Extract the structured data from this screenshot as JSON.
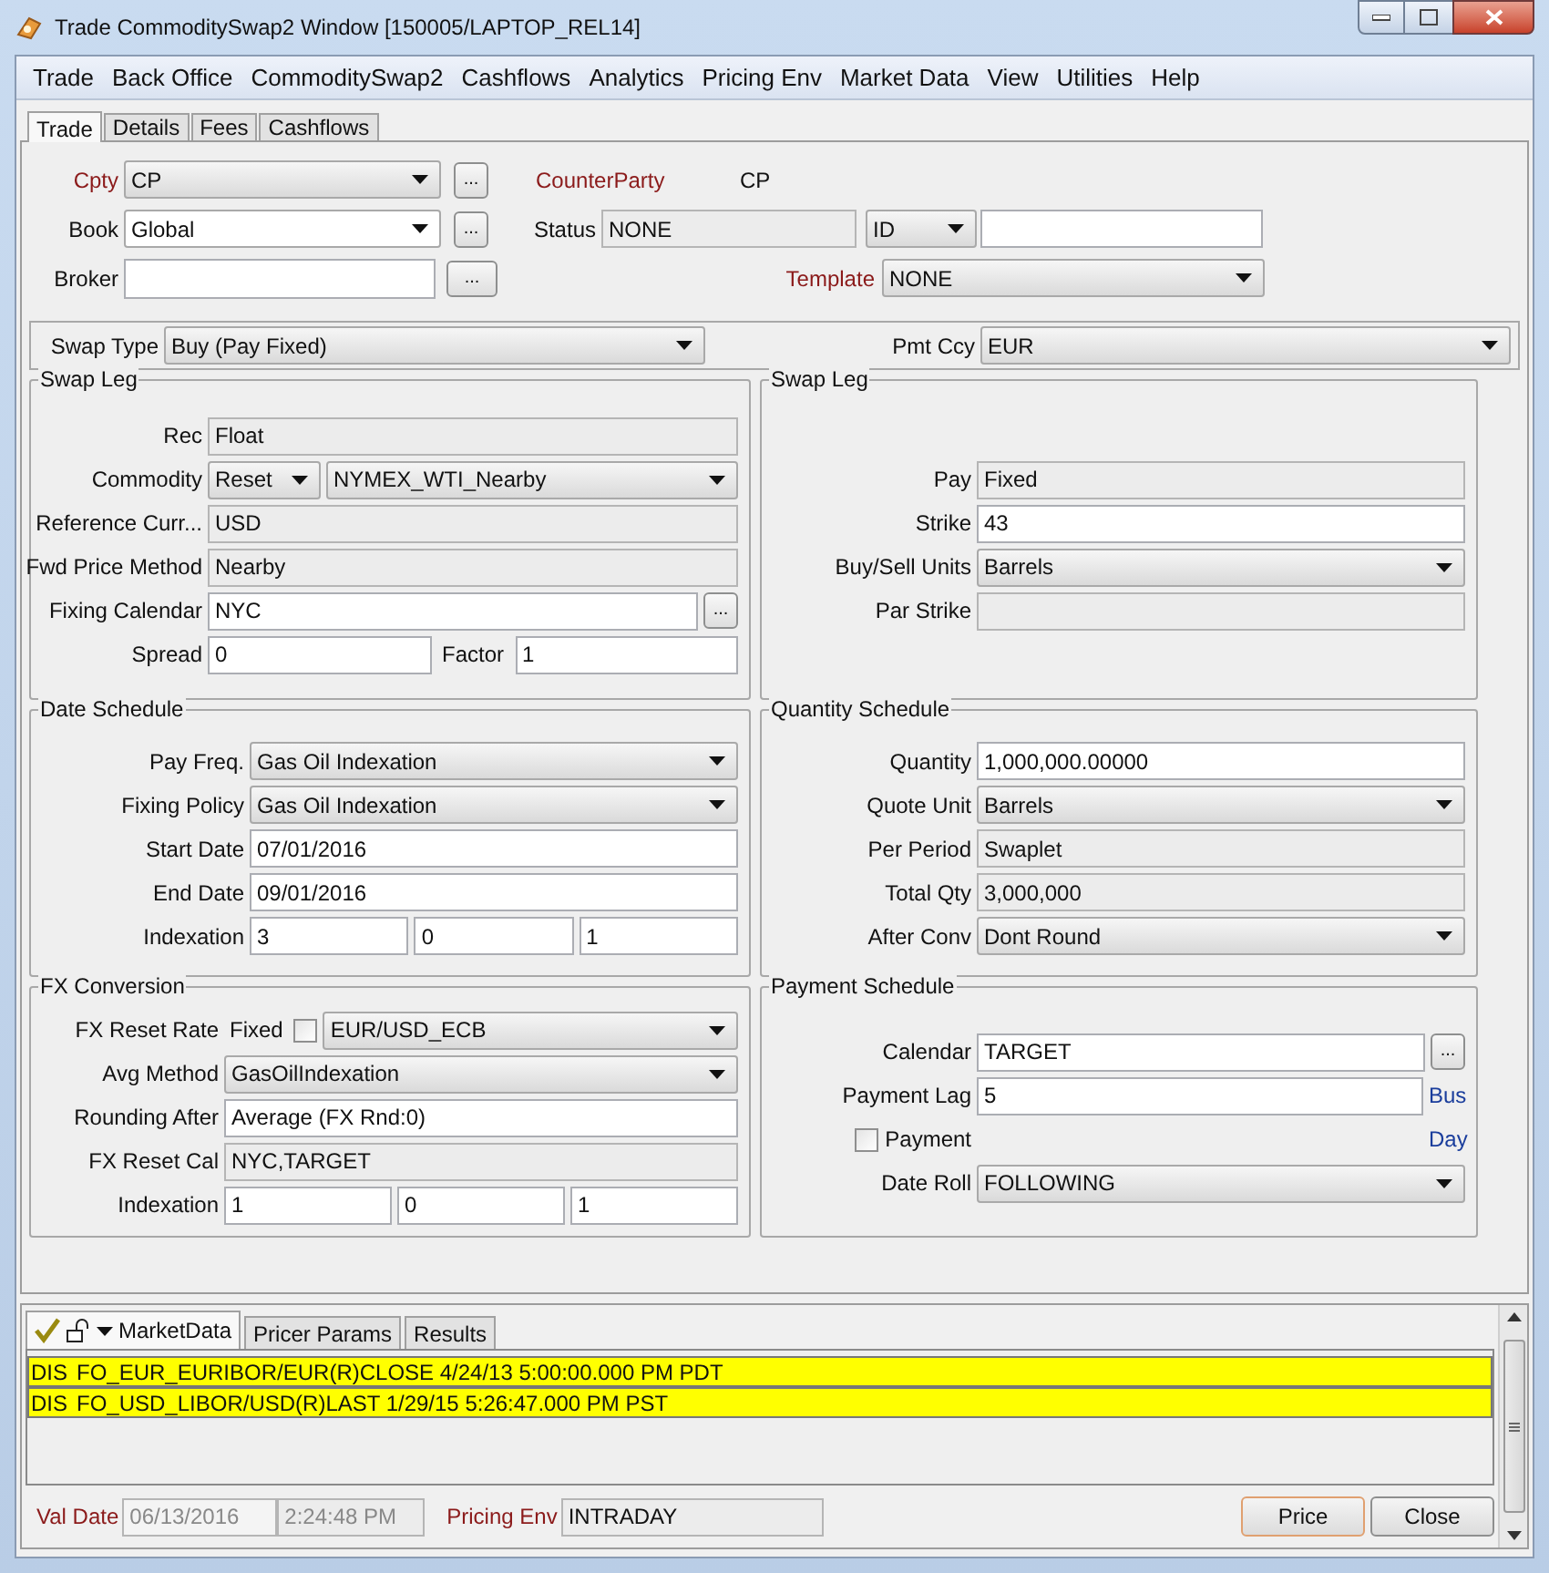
{
  "window": {
    "title": "Trade CommoditySwap2 Window  [150005/LAPTOP_REL14]"
  },
  "menu": [
    "Trade",
    "Back Office",
    "CommoditySwap2",
    "Cashflows",
    "Analytics",
    "Pricing Env",
    "Market Data",
    "View",
    "Utilities",
    "Help"
  ],
  "tabs": [
    {
      "label": "Trade",
      "selected": true
    },
    {
      "label": "Details",
      "selected": false
    },
    {
      "label": "Fees",
      "selected": false
    },
    {
      "label": "Cashflows",
      "selected": false
    }
  ],
  "header": {
    "cpty": {
      "label": "Cpty",
      "required": true,
      "value": "CP",
      "button": "..."
    },
    "counterparty": {
      "label": "CounterParty",
      "required": true,
      "value": "CP"
    },
    "book": {
      "label": "Book",
      "required": false,
      "value": "Global",
      "button": "..."
    },
    "status": {
      "label": "Status",
      "required": false,
      "value": "NONE"
    },
    "id": {
      "type": "ID"
    },
    "broker": {
      "label": "Broker",
      "required": false,
      "button": "..."
    },
    "template": {
      "label": "Template",
      "required": true,
      "value": "NONE"
    }
  },
  "swap_type": {
    "label": "Swap Type",
    "value": "Buy (Pay Fixed)"
  },
  "pmt_ccy": {
    "label": "Pmt Ccy",
    "value": "EUR"
  },
  "panels": [
    {
      "title": "Swap Leg",
      "rows": [
        {
          "label": "Rec",
          "controls": [
            {
              "kind": "readonly",
              "value": "Float"
            }
          ]
        },
        {
          "label": "Commodity",
          "controls": [
            {
              "kind": "short_combo",
              "value": "Reset"
            },
            {
              "kind": "combo",
              "value": "NYMEX_WTI_Nearby"
            }
          ]
        },
        {
          "label": "Reference Curr...",
          "controls": [
            {
              "kind": "readonly",
              "value": "USD"
            }
          ]
        },
        {
          "label": "Fwd Price Method",
          "controls": [
            {
              "kind": "readonly",
              "value": "Nearby"
            }
          ]
        },
        {
          "label": "Fixing Calendar",
          "controls": [
            {
              "kind": "text",
              "value": "NYC"
            },
            {
              "kind": "ellipsis",
              "label": "..."
            }
          ]
        },
        {
          "label": "Spread",
          "controls": [
            {
              "kind": "text",
              "value": "0"
            },
            {
              "kind": "label",
              "value": "Factor"
            },
            {
              "kind": "text",
              "value": "1"
            }
          ]
        }
      ]
    },
    {
      "title": "Swap Leg",
      "rows": [
        {
          "label": "Pay",
          "controls": [
            {
              "kind": "readonly",
              "value": "Fixed"
            }
          ]
        },
        {
          "label": "Strike",
          "controls": [
            {
              "kind": "text",
              "value": "43"
            }
          ]
        },
        {
          "label": "Buy/Sell Units",
          "controls": [
            {
              "kind": "combo",
              "value": "Barrels"
            }
          ]
        },
        {
          "label": "Par Strike",
          "controls": [
            {
              "kind": "readonly"
            }
          ]
        }
      ]
    },
    {
      "title": "Date Schedule",
      "rows": [
        {
          "label": "Pay Freq.",
          "controls": [
            {
              "kind": "combo",
              "value": "Gas Oil Indexation"
            }
          ]
        },
        {
          "label": "Fixing Policy",
          "controls": [
            {
              "kind": "combo",
              "value": "Gas Oil Indexation"
            }
          ]
        },
        {
          "label": "Start Date",
          "controls": [
            {
              "kind": "text",
              "value": "07/01/2016"
            }
          ]
        },
        {
          "label": "End Date",
          "controls": [
            {
              "kind": "text",
              "value": "09/01/2016"
            }
          ]
        },
        {
          "label": "Indexation",
          "controls": [
            {
              "kind": "text",
              "value": "3"
            },
            {
              "kind": "text",
              "value": "0"
            },
            {
              "kind": "text",
              "value": "1"
            }
          ]
        }
      ]
    },
    {
      "title": "Quantity Schedule",
      "rows": [
        {
          "label": "Quantity",
          "controls": [
            {
              "kind": "text",
              "value": "1,000,000.00000"
            }
          ]
        },
        {
          "label": "Quote Unit",
          "controls": [
            {
              "kind": "combo",
              "value": "Barrels"
            }
          ]
        },
        {
          "label": "Per Period",
          "controls": [
            {
              "kind": "readonly",
              "value": "Swaplet"
            }
          ]
        },
        {
          "label": "Total Qty",
          "controls": [
            {
              "kind": "readonly",
              "value": "3,000,000"
            }
          ]
        },
        {
          "label": "After Conv",
          "controls": [
            {
              "kind": "combo",
              "value": "Dont Round"
            }
          ]
        }
      ]
    },
    {
      "title": "FX Conversion",
      "rows": [
        {
          "label": "FX Reset Rate",
          "controls": [
            {
              "kind": "label",
              "value": "Fixed"
            },
            {
              "kind": "checkbox",
              "checked": false
            },
            {
              "kind": "combo",
              "value": "EUR/USD_ECB"
            }
          ]
        },
        {
          "label": "Avg Method",
          "controls": [
            {
              "kind": "combo",
              "value": "GasOilIndexation"
            }
          ]
        },
        {
          "label": "Rounding After",
          "controls": [
            {
              "kind": "text",
              "value": "Average (FX Rnd:0)"
            }
          ]
        },
        {
          "label": "FX Reset Cal",
          "controls": [
            {
              "kind": "readonly",
              "value": "NYC,TARGET"
            }
          ]
        },
        {
          "label": "Indexation",
          "controls": [
            {
              "kind": "text",
              "value": "1"
            },
            {
              "kind": "text",
              "value": "0"
            },
            {
              "kind": "text",
              "value": "1"
            }
          ]
        }
      ]
    },
    {
      "title": "Payment Schedule",
      "rows": [
        {
          "label": "Calendar",
          "controls": [
            {
              "kind": "text",
              "value": "TARGET"
            },
            {
              "kind": "ellipsis",
              "label": "..."
            }
          ]
        },
        {
          "label": "Payment Lag",
          "controls": [
            {
              "kind": "text",
              "value": "5"
            },
            {
              "kind": "suffix",
              "value": "Bus"
            }
          ]
        },
        {
          "check": {
            "label": "Payment",
            "checked": false
          },
          "controls": [
            {
              "kind": "gap"
            },
            {
              "kind": "suffix",
              "value": "Day"
            }
          ]
        },
        {
          "label": "Date Roll",
          "controls": [
            {
              "kind": "combo",
              "value": "FOLLOWING"
            }
          ]
        }
      ]
    }
  ],
  "bottom": {
    "tabs": [
      {
        "label": "MarketData",
        "selected": true
      },
      {
        "label": "Pricer Params",
        "selected": false
      },
      {
        "label": "Results",
        "selected": false
      }
    ],
    "rows": [
      {
        "cells": [
          "DIS",
          "FO_EUR_EURIBOR/EUR(R)CLOSE 4/24/13 5:00:00.000 PM PDT"
        ]
      },
      {
        "cells": [
          "DIS",
          "FO_USD_LIBOR/USD(R)LAST 1/29/15 5:26:47.000 PM PST"
        ]
      }
    ],
    "val_date": {
      "label": "Val Date",
      "required": true,
      "date": "06/13/2016",
      "time": "2:24:48 PM"
    },
    "pricing_env": {
      "label": "Pricing Env",
      "required": true,
      "value": "INTRADAY"
    },
    "buttons": [
      {
        "label": "Price",
        "default": true
      },
      {
        "label": "Close",
        "default": false
      }
    ]
  }
}
